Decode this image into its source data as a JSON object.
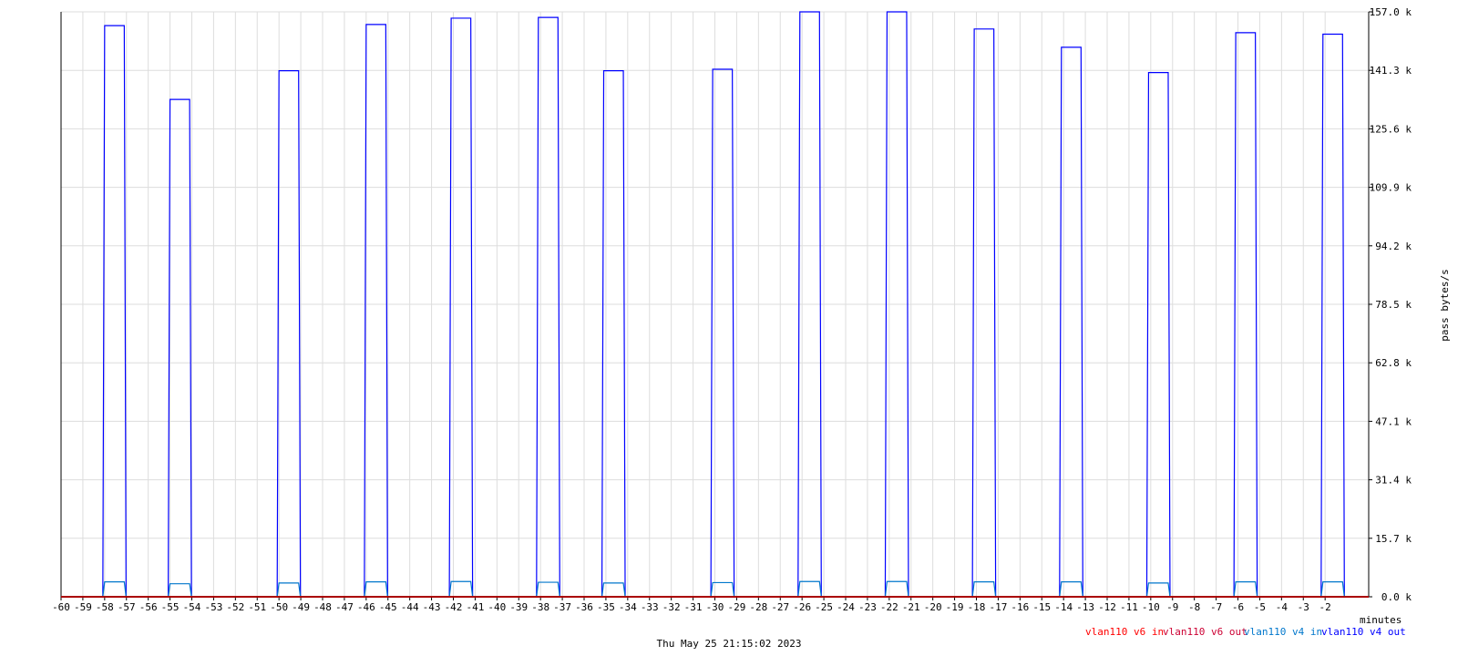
{
  "chart_data": {
    "type": "area",
    "xlabel": "minutes",
    "ylabel": "pass bytes/s",
    "timestamp": "Thu May 25 21:15:02 2023",
    "xlim": [
      -60,
      0
    ],
    "ylim": [
      0,
      157.0
    ],
    "x_ticks": [
      -60,
      -59,
      -58,
      -57,
      -56,
      -55,
      -54,
      -53,
      -52,
      -51,
      -50,
      -49,
      -48,
      -47,
      -46,
      -45,
      -44,
      -43,
      -42,
      -41,
      -40,
      -39,
      -38,
      -37,
      -36,
      -35,
      -34,
      -33,
      -32,
      -31,
      -30,
      -29,
      -28,
      -27,
      -26,
      -25,
      -24,
      -23,
      -22,
      -21,
      -20,
      -19,
      -18,
      -17,
      -16,
      -15,
      -14,
      -13,
      -12,
      -11,
      -10,
      -9,
      -8,
      -7,
      -6,
      -5,
      -4,
      -3,
      -2
    ],
    "y_ticks": [
      "0.0 k",
      "15.7 k",
      "31.4 k",
      "47.1 k",
      "62.8 k",
      "78.5 k",
      "94.2 k",
      "109.9 k",
      "125.6 k",
      "141.3 k",
      "157.0 k"
    ],
    "grid": true,
    "legend_position": "bottom-right",
    "series": [
      {
        "name": "vlan110 v6 in",
        "color": "#ff0000",
        "bursts": []
      },
      {
        "name": "vlan110 v6 out",
        "color": "#cc0033",
        "bursts": []
      },
      {
        "name": "vlan110 v4 in",
        "color": "#0077cc",
        "bursts": [
          {
            "start": -58.0,
            "end": -57.1,
            "value": 4.0
          },
          {
            "start": -55.0,
            "end": -54.1,
            "value": 3.5
          },
          {
            "start": -50.0,
            "end": -49.1,
            "value": 3.7
          },
          {
            "start": -46.0,
            "end": -45.1,
            "value": 4.0
          },
          {
            "start": -42.1,
            "end": -41.2,
            "value": 4.1
          },
          {
            "start": -38.1,
            "end": -37.2,
            "value": 3.9
          },
          {
            "start": -35.1,
            "end": -34.2,
            "value": 3.7
          },
          {
            "start": -30.1,
            "end": -29.2,
            "value": 3.8
          },
          {
            "start": -26.1,
            "end": -25.2,
            "value": 4.1
          },
          {
            "start": -22.1,
            "end": -21.2,
            "value": 4.1
          },
          {
            "start": -18.1,
            "end": -17.2,
            "value": 4.0
          },
          {
            "start": -14.1,
            "end": -13.2,
            "value": 4.0
          },
          {
            "start": -10.1,
            "end": -9.2,
            "value": 3.7
          },
          {
            "start": -6.1,
            "end": -5.2,
            "value": 4.0
          },
          {
            "start": -2.1,
            "end": -1.2,
            "value": 4.0
          }
        ]
      },
      {
        "name": "vlan110 v4 out",
        "color": "#0000ff",
        "bursts": [
          {
            "start": -58.0,
            "end": -57.1,
            "value": 153.3
          },
          {
            "start": -55.0,
            "end": -54.1,
            "value": 133.5
          },
          {
            "start": -50.0,
            "end": -49.1,
            "value": 141.2
          },
          {
            "start": -46.0,
            "end": -45.1,
            "value": 153.6
          },
          {
            "start": -42.1,
            "end": -41.2,
            "value": 155.3
          },
          {
            "start": -38.1,
            "end": -37.2,
            "value": 155.5
          },
          {
            "start": -35.1,
            "end": -34.2,
            "value": 141.2
          },
          {
            "start": -30.1,
            "end": -29.2,
            "value": 141.6
          },
          {
            "start": -26.1,
            "end": -25.2,
            "value": 157.0
          },
          {
            "start": -22.1,
            "end": -21.2,
            "value": 157.0
          },
          {
            "start": -18.1,
            "end": -17.2,
            "value": 152.4
          },
          {
            "start": -14.1,
            "end": -13.2,
            "value": 147.5
          },
          {
            "start": -10.1,
            "end": -9.2,
            "value": 140.7
          },
          {
            "start": -6.1,
            "end": -5.2,
            "value": 151.4
          },
          {
            "start": -2.1,
            "end": -1.2,
            "value": 151.0
          }
        ]
      }
    ]
  }
}
